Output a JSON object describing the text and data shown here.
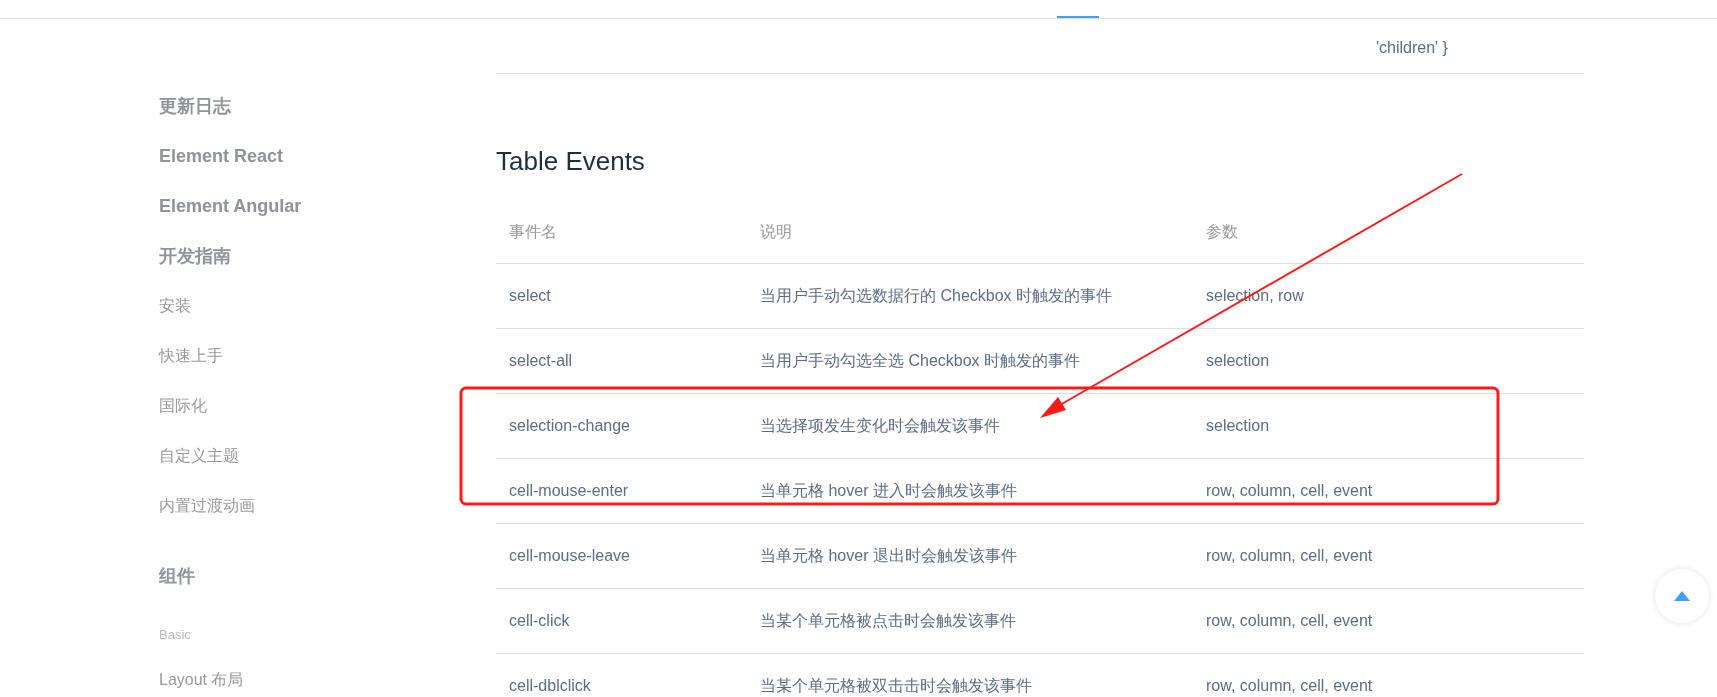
{
  "sidebar": {
    "items": [
      {
        "kind": "heading",
        "label": "更新日志"
      },
      {
        "kind": "heading",
        "label": "Element React"
      },
      {
        "kind": "heading",
        "label": "Element Angular"
      },
      {
        "kind": "heading",
        "label": "开发指南"
      },
      {
        "kind": "item",
        "label": "安装"
      },
      {
        "kind": "item",
        "label": "快速上手"
      },
      {
        "kind": "item",
        "label": "国际化"
      },
      {
        "kind": "item",
        "label": "自定义主题"
      },
      {
        "kind": "item",
        "label": "内置过渡动画"
      },
      {
        "kind": "heading",
        "label": "组件"
      },
      {
        "kind": "group",
        "label": "Basic"
      },
      {
        "kind": "item",
        "label": "Layout 布局"
      }
    ]
  },
  "attributes_table_last_row": {
    "cells": [
      "'children' }"
    ]
  },
  "section_title": "Table Events",
  "table": {
    "columns": [
      "事件名",
      "说明",
      "参数"
    ],
    "rows": [
      [
        "select",
        "当用户手动勾选数据行的 Checkbox 时触发的事件",
        "selection, row"
      ],
      [
        "select-all",
        "当用户手动勾选全选 Checkbox 时触发的事件",
        "selection"
      ],
      [
        "selection-change",
        "当选择项发生变化时会触发该事件",
        "selection"
      ],
      [
        "cell-mouse-enter",
        "当单元格 hover 进入时会触发该事件",
        "row, column, cell, event"
      ],
      [
        "cell-mouse-leave",
        "当单元格 hover 退出时会触发该事件",
        "row, column, cell, event"
      ],
      [
        "cell-click",
        "当某个单元格被点击时会触发该事件",
        "row, column, cell, event"
      ],
      [
        "cell-dblclick",
        "当某个单元格被双击击时会触发该事件",
        "row, column, cell, event"
      ]
    ]
  }
}
